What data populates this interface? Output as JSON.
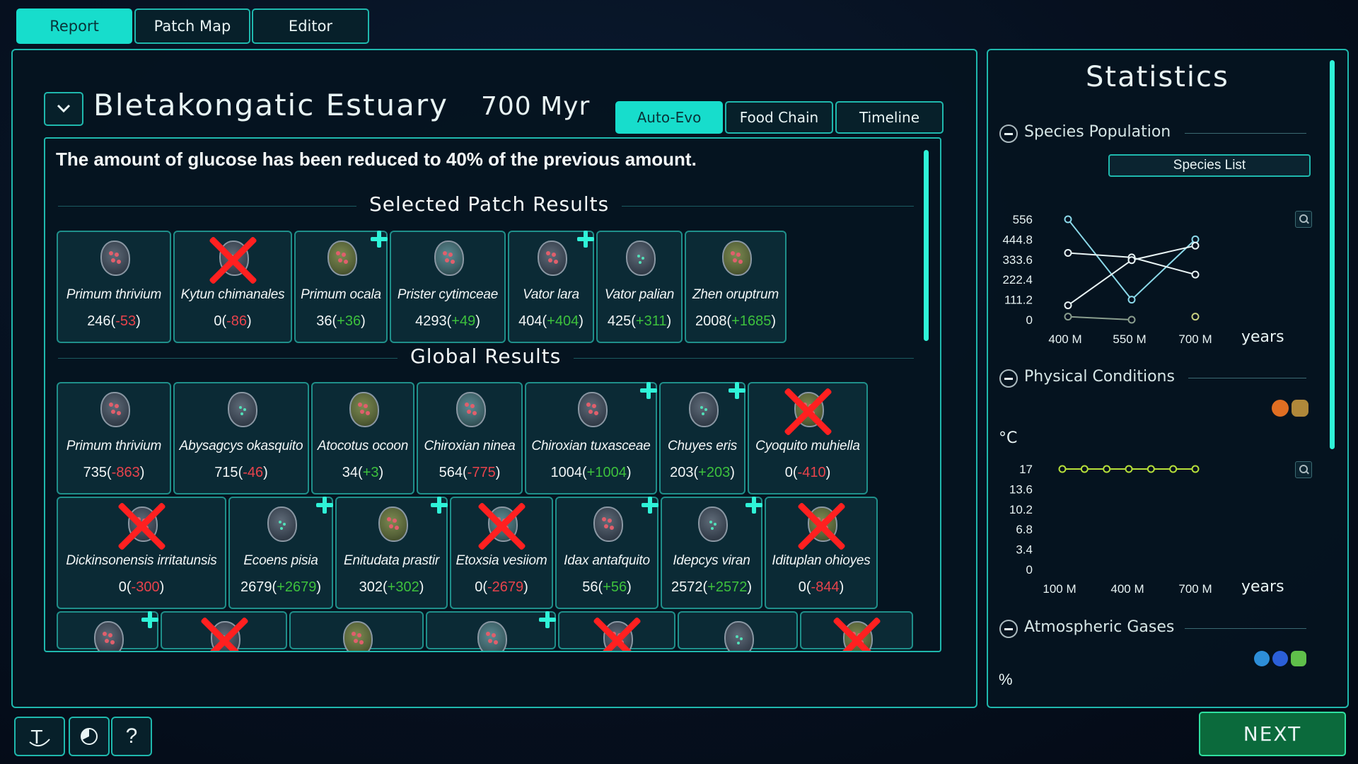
{
  "top_tabs": [
    "Report",
    "Patch Map",
    "Editor"
  ],
  "patch": {
    "name": "Bletakongatic Estuary",
    "time": "700 Myr"
  },
  "sub_tabs": [
    "Auto-Evo",
    "Food Chain",
    "Timeline"
  ],
  "message": "The amount of glucose has been reduced to 40% of the previous amount.",
  "sections": {
    "selected": "Selected Patch Results",
    "global": "Global Results"
  },
  "selected_results": [
    {
      "name": "Primum thrivium",
      "pop": "246",
      "change": "-53",
      "status": "normal"
    },
    {
      "name": "Kytun chimanales",
      "pop": "0",
      "change": "-86",
      "status": "extinct"
    },
    {
      "name": "Primum ocala",
      "pop": "36",
      "change": "+36",
      "status": "new"
    },
    {
      "name": "Prister cytimceae",
      "pop": "4293",
      "change": "+49",
      "status": "normal"
    },
    {
      "name": "Vator lara",
      "pop": "404",
      "change": "+404",
      "status": "new"
    },
    {
      "name": "Vator palian",
      "pop": "425",
      "change": "+311",
      "status": "normal"
    },
    {
      "name": "Zhen oruptrum",
      "pop": "2008",
      "change": "+1685",
      "status": "normal"
    }
  ],
  "global_results_row1": [
    {
      "name": "Primum thrivium",
      "pop": "735",
      "change": "-863",
      "status": "normal"
    },
    {
      "name": "Abysagcys okasquito",
      "pop": "715",
      "change": "-46",
      "status": "normal"
    },
    {
      "name": "Atocotus ocoon",
      "pop": "34",
      "change": "+3",
      "status": "normal"
    },
    {
      "name": "Chiroxian ninea",
      "pop": "564",
      "change": "-775",
      "status": "normal"
    },
    {
      "name": "Chiroxian tuxasceae",
      "pop": "1004",
      "change": "+1004",
      "status": "new"
    },
    {
      "name": "Chuyes eris",
      "pop": "203",
      "change": "+203",
      "status": "new"
    },
    {
      "name": "Cyoquito muhiella",
      "pop": "0",
      "change": "-410",
      "status": "extinct"
    }
  ],
  "global_results_row2": [
    {
      "name": "Dickinsonensis irritatunsis",
      "pop": "0",
      "change": "-300",
      "status": "extinct"
    },
    {
      "name": "Ecoens pisia",
      "pop": "2679",
      "change": "+2679",
      "status": "new"
    },
    {
      "name": "Enitudata prastir",
      "pop": "302",
      "change": "+302",
      "status": "new"
    },
    {
      "name": "Etoxsia vesiiom",
      "pop": "0",
      "change": "-2679",
      "status": "extinct"
    },
    {
      "name": "Idax antafquito",
      "pop": "56",
      "change": "+56",
      "status": "new"
    },
    {
      "name": "Idepcys viran",
      "pop": "2572",
      "change": "+2572",
      "status": "new"
    },
    {
      "name": "Idituplan ohioyes",
      "pop": "0",
      "change": "-844",
      "status": "extinct"
    }
  ],
  "global_results_row3": [
    {
      "status": "new"
    },
    {
      "status": "extinct"
    },
    {
      "status": "normal"
    },
    {
      "status": "new"
    },
    {
      "status": "extinct"
    },
    {
      "status": "normal"
    },
    {
      "status": "extinct"
    }
  ],
  "statistics": {
    "title": "Statistics",
    "species_population": "Species Population",
    "species_list": "Species List",
    "physical_conditions": "Physical Conditions",
    "atmospheric_gases": "Atmospheric Gases",
    "percent_unit": "%"
  },
  "chart_data": [
    {
      "type": "line",
      "title": "Species Population",
      "x": [
        "400 M",
        "550 M",
        "700 M"
      ],
      "xlabel": "years",
      "ylim": [
        0,
        556
      ],
      "yticks": [
        "556",
        "444.8",
        "333.6",
        "222.4",
        "111.2",
        "0"
      ],
      "series": [
        {
          "values": [
            556,
            111,
            445
          ],
          "color": "#8ad8e8"
        },
        {
          "values": [
            370,
            345,
            250
          ],
          "color": "#e8f4f4"
        },
        {
          "values": [
            80,
            330,
            410
          ],
          "color": "#e8f4f4"
        },
        {
          "values": [
            17,
            0,
            null
          ],
          "color": "#8a9e8e"
        },
        {
          "values": [
            null,
            null,
            17
          ],
          "color": "#c8d080"
        }
      ]
    },
    {
      "type": "line",
      "title": "Physical Conditions",
      "ylabel": "°C",
      "x": [
        "100 M",
        "400 M",
        "700 M"
      ],
      "xlabel": "years",
      "ylim": [
        0,
        17
      ],
      "yticks": [
        "17",
        "13.6",
        "10.2",
        "6.8",
        "3.4",
        "0"
      ],
      "series": [
        {
          "values": [
            17,
            17,
            17,
            17,
            17,
            17,
            17
          ],
          "color": "#b6e03a"
        }
      ]
    }
  ],
  "bottom": {
    "next": "NEXT",
    "help": "?"
  }
}
